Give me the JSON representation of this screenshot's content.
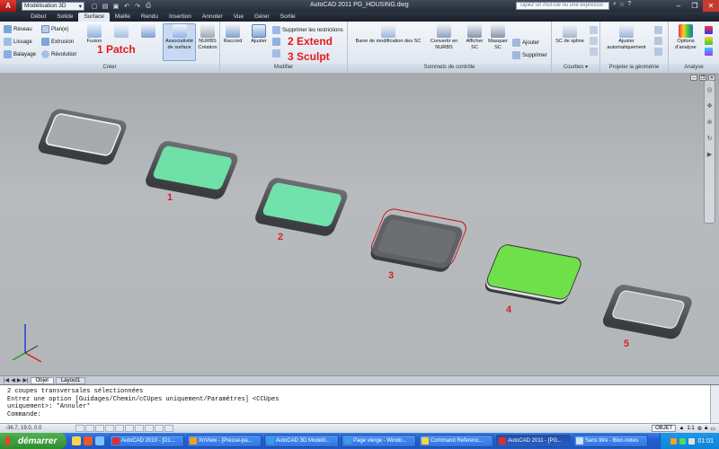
{
  "titlebar": {
    "workspace": "Modélisation 3D",
    "title": "AutoCAD 2011    PG_HOUSING.dwg",
    "search_placeholder": "Tapez un mot-clé ou une expressio"
  },
  "tabs": [
    "Début",
    "Solide",
    "Surface",
    "Maille",
    "Rendu",
    "Insertion",
    "Annoter",
    "Vue",
    "Gérer",
    "Sortie"
  ],
  "active_tab": "Surface",
  "ribbon": {
    "creer": {
      "label": "Créer",
      "items": [
        "Réseau",
        "Lissage",
        "Balayage",
        "Plan(e)",
        "Extrusion",
        "Révolution",
        "Fusion",
        "Raccorder",
        "Associativité de surface",
        "NURBS Création"
      ]
    },
    "modifier": {
      "label": "Modifier",
      "items": [
        "Raccord",
        "Ajuster",
        "Supprimer les restrictions",
        "Prolonger",
        "Sculpter"
      ]
    },
    "sommets": {
      "label": "Sommets de contrôle",
      "items": [
        "Barre de modification des SC",
        "Convertir en NURBS",
        "Afficher SC",
        "Masquer SC",
        "Ajouter",
        "Supprimer"
      ]
    },
    "courbes": {
      "label": "Courbes",
      "items": [
        "SC de spline"
      ]
    },
    "projeter": {
      "label": "Projeter la géométrie",
      "items": [
        "Ajuster automatiquement"
      ]
    },
    "analyse": {
      "label": "Analyse",
      "items": [
        "Options d'analyse"
      ]
    }
  },
  "annotations": [
    "1 Patch",
    "2 Extend",
    "3 Sculpt"
  ],
  "viewport_labels": [
    "1",
    "2",
    "3",
    "4",
    "5"
  ],
  "layout_tabs": [
    "Objet",
    "Layout1"
  ],
  "command_lines": [
    "  2 coupes transversales sélectionnées",
    "Entrez une option [Guidages/Chemin/cCUpes uniquement/Paramètres] <CCUpes",
    "uniquement>: *Annuler*",
    "Commande:"
  ],
  "statusbar": {
    "coords": "-36.7, 19.0, 0.0",
    "objet": "OBJET",
    "scale": "1:1"
  },
  "taskbar": {
    "start": "démarrer",
    "items": [
      "AutoCAD 2010 - [D1...",
      "XnView - [Presse-pa...",
      "AutoCAD 3D Modelli...",
      "Page vierge - Windo...",
      "Command Referenc...",
      "AutoCAD 2011 - [PG...",
      "Sans titre - Bloc-notes"
    ],
    "clock": "01:01"
  },
  "colors": {
    "accent_red": "#e3191b",
    "patch_green": "#6ee0a8",
    "sculpt_green": "#6fe049",
    "viewport_bg": "#b3b6b9"
  }
}
